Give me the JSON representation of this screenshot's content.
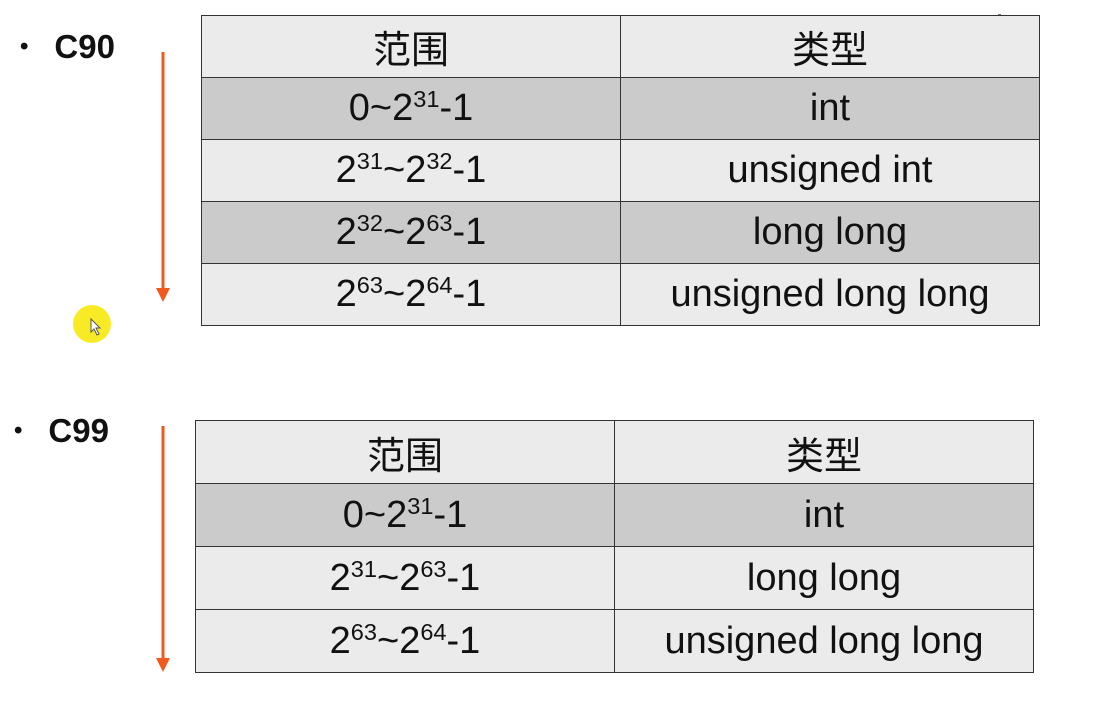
{
  "sections": [
    {
      "label": "C90",
      "headers": {
        "range": "范围",
        "type": "类型"
      },
      "rows": [
        {
          "range": {
            "parts": [
              {
                "t": "0~2"
              },
              {
                "s": "31"
              },
              {
                "t": "-1"
              }
            ]
          },
          "type": "int",
          "shade": "dark"
        },
        {
          "range": {
            "parts": [
              {
                "t": "2"
              },
              {
                "s": "31"
              },
              {
                "t": "~2"
              },
              {
                "s": "32"
              },
              {
                "t": "-1"
              }
            ]
          },
          "type": "unsigned int",
          "shade": "light"
        },
        {
          "range": {
            "parts": [
              {
                "t": "2"
              },
              {
                "s": "32"
              },
              {
                "t": "~2"
              },
              {
                "s": "63"
              },
              {
                "t": "-1"
              }
            ]
          },
          "type": "long long",
          "shade": "dark"
        },
        {
          "range": {
            "parts": [
              {
                "t": "2"
              },
              {
                "s": "63"
              },
              {
                "t": "~2"
              },
              {
                "s": "64"
              },
              {
                "t": "-1"
              }
            ]
          },
          "type": "unsigned long long",
          "shade": "light"
        }
      ]
    },
    {
      "label": "C99",
      "headers": {
        "range": "范围",
        "type": "类型"
      },
      "rows": [
        {
          "range": {
            "parts": [
              {
                "t": "0~2"
              },
              {
                "s": "31"
              },
              {
                "t": "-1"
              }
            ]
          },
          "type": "int",
          "shade": "dark"
        },
        {
          "range": {
            "parts": [
              {
                "t": "2"
              },
              {
                "s": "31"
              },
              {
                "t": "~2"
              },
              {
                "s": "63"
              },
              {
                "t": "-1"
              }
            ]
          },
          "type": "long long",
          "shade": "light"
        },
        {
          "range": {
            "parts": [
              {
                "t": "2"
              },
              {
                "s": "63"
              },
              {
                "t": "~2"
              },
              {
                "s": "64"
              },
              {
                "t": "-1"
              }
            ]
          },
          "type": "unsigned long long",
          "shade": "light"
        }
      ]
    }
  ],
  "colors": {
    "arrow": "#f05a1e",
    "row_dark": "#cbcbcb",
    "row_light": "#ebebeb",
    "cursor_highlight": "#f7e700"
  },
  "icons": {
    "cursor": "mouse-pointer-icon",
    "arrow": "arrow-down-icon",
    "bullet": "bullet-dot-icon"
  }
}
